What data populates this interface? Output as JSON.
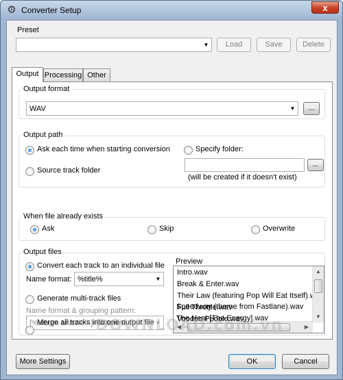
{
  "window": {
    "title": "Converter Setup",
    "close_label": "x",
    "gear_glyph": "⚙"
  },
  "preset": {
    "label": "Preset",
    "value": "",
    "buttons": {
      "load": "Load",
      "save": "Save",
      "delete": "Delete"
    }
  },
  "tabs": [
    {
      "label": "Output",
      "active": true
    },
    {
      "label": "Processing",
      "active": false
    },
    {
      "label": "Other",
      "active": false
    }
  ],
  "output_format": {
    "title": "Output format",
    "value": "WAV",
    "browse_label": "..."
  },
  "output_path": {
    "title": "Output path",
    "ask_each_time": "Ask each time when starting conversion",
    "source_track_folder": "Source track folder",
    "specify_folder": "Specify folder:",
    "folder_value": "",
    "browse_label": "...",
    "note": "(will be created if it doesn't exist)",
    "selected": "ask_each_time"
  },
  "file_exists": {
    "title": "When file already exists",
    "options": [
      "Ask",
      "Skip",
      "Overwrite"
    ],
    "selected": "Ask"
  },
  "output_files": {
    "title": "Output files",
    "convert_each": "Convert each track to an individual file",
    "name_format_label": "Name format:",
    "name_format_value": "%title%",
    "generate_multi": "Generate multi-track files",
    "grouping_label": "Name format & grouping pattern:",
    "grouping_value": "[%album artist% - ]%album%",
    "merge_all": "Merge all tracks into one output file",
    "selected": "convert_each",
    "preview_label": "Preview",
    "preview_items": [
      "Intro.wav",
      "Break & Enter.wav",
      "Their Law (featuring Pop Will Eat Itself).wav",
      "Full Throttle.wav",
      "Voodoo People.wav",
      "Speedway (theme from Fastlane).wav",
      "The Heat [The Energy].wav"
    ]
  },
  "footer": {
    "more_settings": "More Settings",
    "ok": "OK",
    "cancel": "Cancel"
  },
  "watermark": "DOWNLOAD.com.vn"
}
